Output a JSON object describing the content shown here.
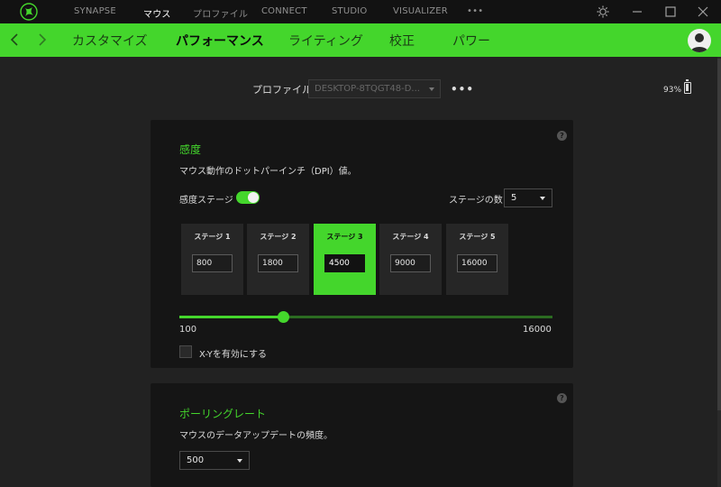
{
  "app": {
    "top_nav": [
      {
        "label": "SYNAPSE",
        "active": false
      },
      {
        "label": "マウス",
        "active": true
      },
      {
        "label": "プロファイル",
        "active": false
      },
      {
        "label": "CONNECT",
        "active": false
      },
      {
        "label": "STUDIO",
        "active": false
      },
      {
        "label": "VISUALIZER",
        "active": false
      }
    ],
    "more_label": "•••"
  },
  "subnav": {
    "tabs": [
      {
        "label": "カスタマイズ",
        "active": false
      },
      {
        "label": "パフォーマンス",
        "active": true
      },
      {
        "label": "ライティング",
        "active": false
      },
      {
        "label": "校正",
        "active": false
      },
      {
        "label": "パワー",
        "active": false
      }
    ]
  },
  "profile": {
    "label": "プロファイル",
    "selected": "DESKTOP-8TQGT48-D...",
    "more_label": "•••",
    "battery": "93%"
  },
  "sensitivity": {
    "title": "感度",
    "description": "マウス動作のドットパーインチ（DPI）値。",
    "stages_label": "感度ステージ",
    "stages_enabled": true,
    "stage_count_label": "ステージの数",
    "stage_count": "5",
    "stages": [
      {
        "name": "ステージ 1",
        "value": "800",
        "active": false
      },
      {
        "name": "ステージ 2",
        "value": "1800",
        "active": false
      },
      {
        "name": "ステージ 3",
        "value": "4500",
        "active": true
      },
      {
        "name": "ステージ 4",
        "value": "9000",
        "active": false
      },
      {
        "name": "ステージ 5",
        "value": "16000",
        "active": false
      }
    ],
    "slider_min": "100",
    "slider_max": "16000",
    "slider_value": 4500,
    "xy_label": "X-Yを有効にする",
    "xy_enabled": false
  },
  "polling": {
    "title": "ポーリングレート",
    "description": "マウスのデータアップデートの頻度。",
    "value": "500"
  },
  "colors": {
    "accent": "#44d62c",
    "background": "#222222",
    "card": "#151515"
  },
  "icons": [
    "razer-logo-icon",
    "settings-icon",
    "minimize-icon",
    "maximize-icon",
    "close-icon",
    "back-arrow-icon",
    "forward-arrow-icon",
    "user-avatar-icon",
    "battery-icon",
    "help-icon"
  ]
}
